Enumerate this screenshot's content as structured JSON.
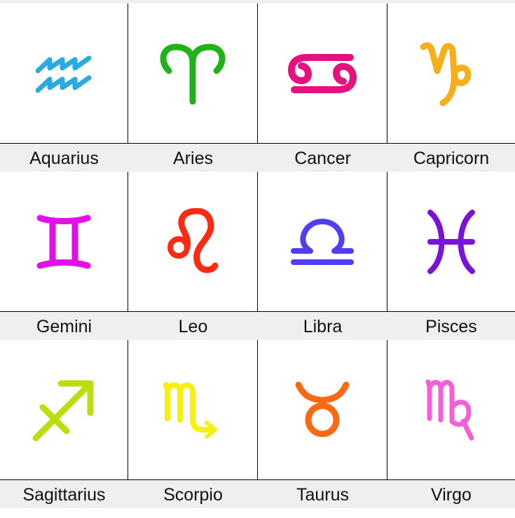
{
  "signs": [
    {
      "name": "Aquarius",
      "symbol": "aquarius-icon",
      "color": "#29abe2"
    },
    {
      "name": "Aries",
      "symbol": "aries-icon",
      "color": "#1fb318"
    },
    {
      "name": "Cancer",
      "symbol": "cancer-icon",
      "color": "#e3127c"
    },
    {
      "name": "Capricorn",
      "symbol": "capricorn-icon",
      "color": "#f7ae1b"
    },
    {
      "name": "Gemini",
      "symbol": "gemini-icon",
      "color": "#e40ee8"
    },
    {
      "name": "Leo",
      "symbol": "leo-icon",
      "color": "#fb2a12"
    },
    {
      "name": "Libra",
      "symbol": "libra-icon",
      "color": "#4f3ff1"
    },
    {
      "name": "Pisces",
      "symbol": "pisces-icon",
      "color": "#7b12d8"
    },
    {
      "name": "Sagittarius",
      "symbol": "sagittarius-icon",
      "color": "#b9df0e"
    },
    {
      "name": "Scorpio",
      "symbol": "scorpio-icon",
      "color": "#f7f00f"
    },
    {
      "name": "Taurus",
      "symbol": "taurus-icon",
      "color": "#fb6a12"
    },
    {
      "name": "Virgo",
      "symbol": "virgo-icon",
      "color": "#f45fd8"
    }
  ]
}
